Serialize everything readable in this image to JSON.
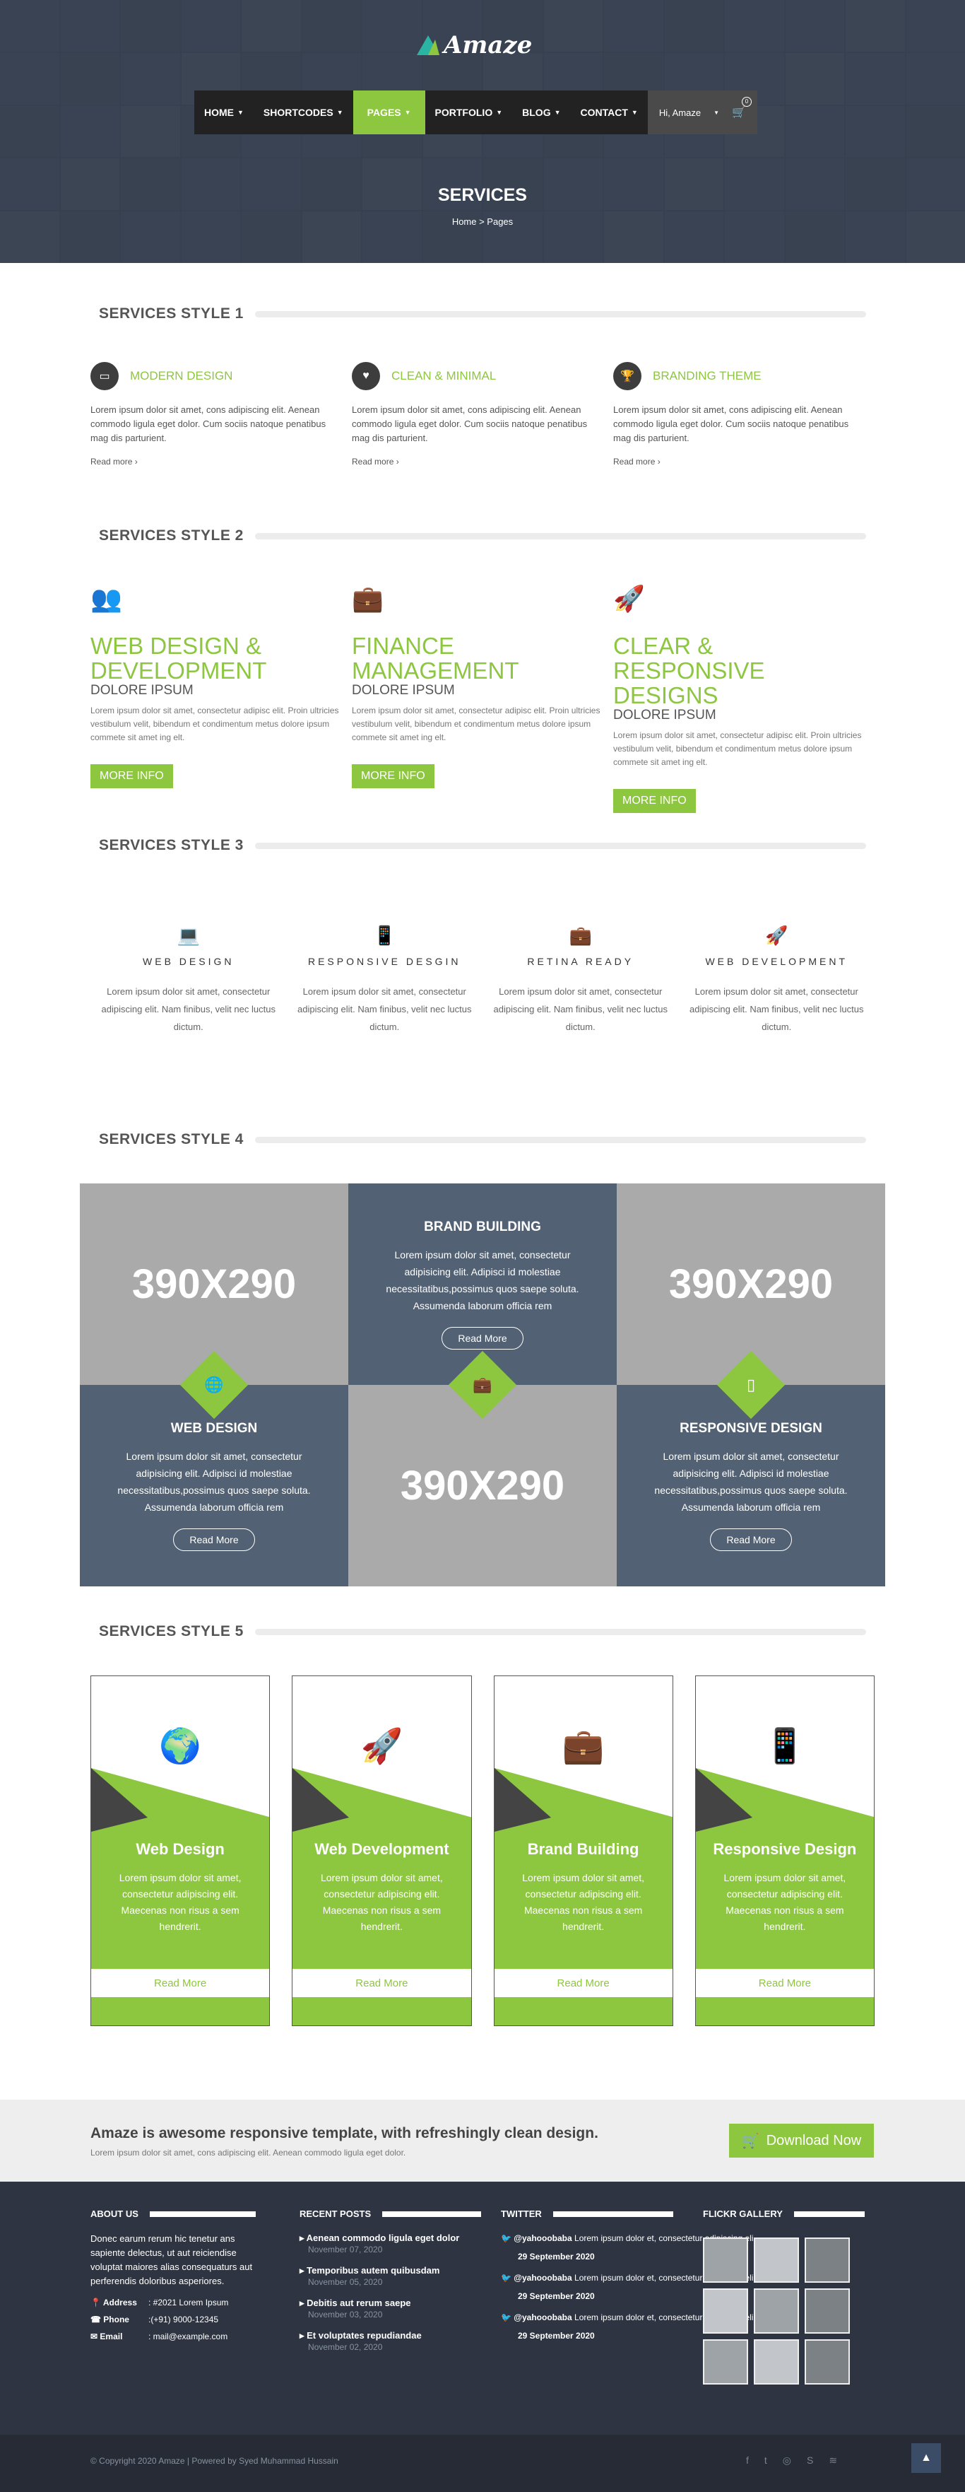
{
  "brand": {
    "name": "Amaze"
  },
  "nav": {
    "items": [
      "HOME",
      "SHORTCODES",
      "PAGES",
      "PORTFOLIO",
      "BLOG",
      "CONTACT"
    ],
    "active": "PAGES",
    "user": "Hi, Amaze",
    "cart_count": "0"
  },
  "hero": {
    "title": "SERVICES",
    "breadcrumb": "Home  >  Pages"
  },
  "style1": {
    "title": "SERVICES STYLE 1",
    "items": [
      {
        "title": "MODERN DESIGN",
        "icon": "laptop-icon",
        "text": "Lorem ipsum dolor sit amet, cons adipiscing elit. Aenean commodo ligula eget dolor. Cum sociis natoque penatibus mag dis parturient.",
        "more": "Read more"
      },
      {
        "title": "CLEAN & MINIMAL",
        "icon": "heart-icon",
        "text": "Lorem ipsum dolor sit amet, cons adipiscing elit. Aenean commodo ligula eget dolor. Cum sociis natoque penatibus mag dis parturient.",
        "more": "Read more"
      },
      {
        "title": "BRANDING THEME",
        "icon": "trophy-icon",
        "text": "Lorem ipsum dolor sit amet, cons adipiscing elit. Aenean commodo ligula eget dolor. Cum sociis natoque penatibus mag dis parturient.",
        "more": "Read more"
      }
    ]
  },
  "style2": {
    "title": "SERVICES STYLE 2",
    "items": [
      {
        "title": "WEB DESIGN & DEVELOPMENT",
        "sub": "DOLORE IPSUM",
        "text": "Lorem ipsum dolor sit amet, consectetur adipisc elit. Proin ultricies vestibulum velit, bibendum et condimentum metus dolore ipsum commete sit amet ing elt.",
        "btn": "MORE INFO",
        "icon": "users-icon"
      },
      {
        "title": "FINANCE MANAGEMENT",
        "sub": "DOLORE IPSUM",
        "text": "Lorem ipsum dolor sit amet, consectetur adipisc elit. Proin ultricies vestibulum velit, bibendum et condimentum metus dolore ipsum commete sit amet ing elt.",
        "btn": "MORE INFO",
        "icon": "briefcase-icon"
      },
      {
        "title": "CLEAR & RESPONSIVE DESIGNS",
        "sub": "DOLORE IPSUM",
        "text": "Lorem ipsum dolor sit amet, consectetur adipisc elit. Proin ultricies vestibulum velit, bibendum et condimentum metus dolore ipsum commete sit amet ing elt.",
        "btn": "MORE INFO",
        "icon": "rocket-icon"
      }
    ]
  },
  "style3": {
    "title": "SERVICES STYLE 3",
    "items": [
      {
        "title": "WEB DESIGN",
        "text": "Lorem ipsum dolor sit amet, consectetur adipiscing elit. Nam finibus, velit nec luctus dictum.",
        "icon": "laptop-icon"
      },
      {
        "title": "RESPONSIVE DESGIN",
        "text": "Lorem ipsum dolor sit amet, consectetur adipiscing elit. Nam finibus, velit nec luctus dictum.",
        "icon": "mobile-icon"
      },
      {
        "title": "RETINA READY",
        "text": "Lorem ipsum dolor sit amet, consectetur adipiscing elit. Nam finibus, velit nec luctus dictum.",
        "icon": "briefcase-icon"
      },
      {
        "title": "WEB DEVELOPMENT",
        "text": "Lorem ipsum dolor sit amet, consectetur adipiscing elit. Nam finibus, velit nec luctus dictum.",
        "icon": "rocket-icon"
      }
    ]
  },
  "style4": {
    "title": "SERVICES STYLE 4",
    "placeholder": "390X290",
    "text": "Lorem ipsum dolor sit amet, consectetur adipisicing elit. Adipisci id molestiae necessitatibus,possimus quos saepe soluta. Assumenda laborum officia rem",
    "items": [
      {
        "title": "BRAND BUILDING",
        "btn": "Read More"
      },
      {
        "title": "WEB DESIGN",
        "btn": "Read More"
      },
      {
        "title": "RESPONSIVE DESIGN",
        "btn": "Read More"
      }
    ]
  },
  "style5": {
    "title": "SERVICES STYLE 5",
    "text": "Lorem ipsum dolor sit amet, consectetur adipiscing elit. Maecenas non risus a sem hendrerit.",
    "more": "Read More",
    "items": [
      {
        "title": "Web Design",
        "icon": "globe-icon"
      },
      {
        "title": "Web Development",
        "icon": "rocket-icon"
      },
      {
        "title": "Brand Building",
        "icon": "briefcase-icon"
      },
      {
        "title": "Responsive Design",
        "icon": "mobile-icon"
      }
    ]
  },
  "cta": {
    "title": "Amaze is awesome responsive template, with refreshingly clean design.",
    "text": "Lorem ipsum dolor sit amet, cons adipiscing elit. Aenean commodo ligula eget dolor.",
    "btn": "Download Now"
  },
  "footer": {
    "about": {
      "title": "ABOUT US",
      "text": "Donec earum rerum hic tenetur ans sapiente delectus, ut aut reiciendise voluptat maiores alias consequaturs aut perferendis doloribus asperiores.",
      "address_k": "Address",
      "address_v": ": #2021 Lorem Ipsum",
      "phone_k": "Phone",
      "phone_v": ":(+91) 9000-12345",
      "email_k": "Email",
      "email_v": ": mail@example.com"
    },
    "posts": {
      "title": "RECENT POSTS",
      "items": [
        {
          "t": "Aenean commodo ligula eget dolor",
          "d": "November 07, 2020"
        },
        {
          "t": "Temporibus autem quibusdam",
          "d": "November 05, 2020"
        },
        {
          "t": "Debitis aut rerum saepe",
          "d": "November 03, 2020"
        },
        {
          "t": "Et voluptates repudiandae",
          "d": "November 02, 2020"
        }
      ]
    },
    "twitter": {
      "title": "TWITTER",
      "handle": "@yahooobaba",
      "text": "Lorem ipsum dolor et, consectetur adipiscing eli",
      "date": "29 September 2020"
    },
    "flickr": {
      "title": "FLICKR GALLERY"
    }
  },
  "copyright": "© Copyright 2020 Amaze | Powered by Syed Muhammad Hussain",
  "colors": {
    "accent": "#8dc63f",
    "dark": "#2e3441",
    "slate": "#526173"
  }
}
